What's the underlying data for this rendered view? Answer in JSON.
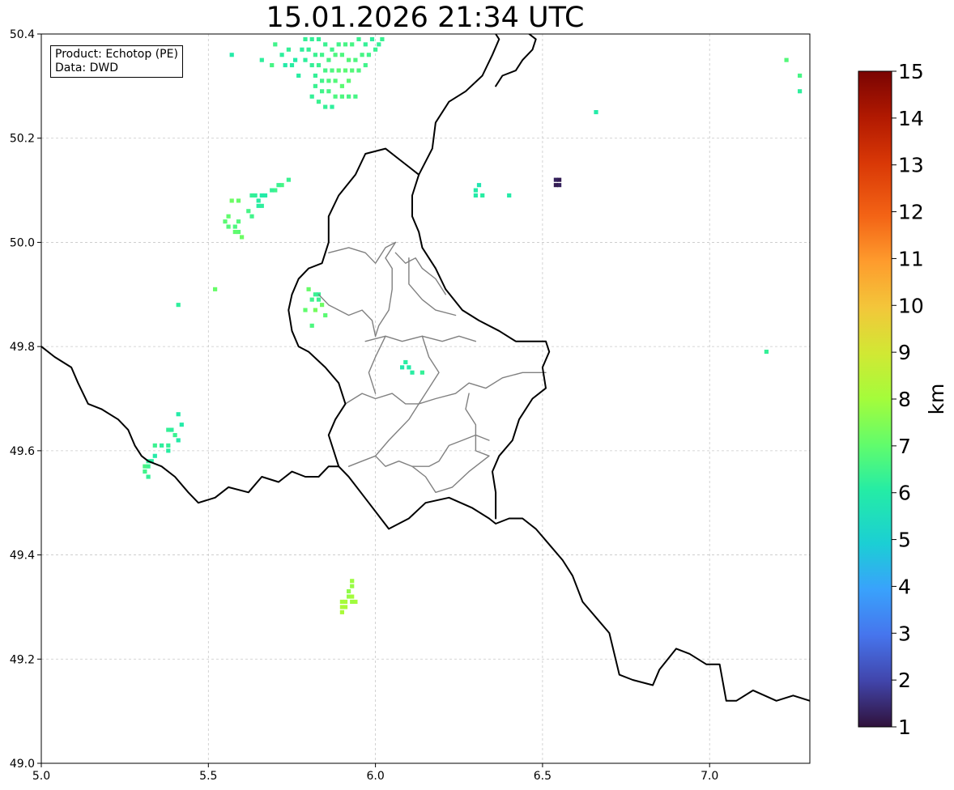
{
  "title": "15.01.2026 21:34 UTC",
  "info": {
    "product": "Product: Echotop (PE)",
    "source": "Data: DWD"
  },
  "map": {
    "lon_range": [
      5.0,
      7.3
    ],
    "lat_range": [
      49.0,
      50.4
    ],
    "lon_ticks": [
      "5.0",
      "5.5",
      "6.0",
      "6.5",
      "7.0"
    ],
    "lat_ticks": [
      "49.0",
      "49.2",
      "49.4",
      "49.6",
      "49.8",
      "50.0",
      "50.2",
      "50.4"
    ],
    "grid": true,
    "national_border_color": "#000000",
    "canton_border_color": "#808080",
    "national_borders": [
      [
        [
          5.0,
          49.8
        ],
        [
          5.04,
          49.78
        ],
        [
          5.09,
          49.76
        ],
        [
          5.11,
          49.73
        ],
        [
          5.14,
          49.69
        ],
        [
          5.18,
          49.68
        ],
        [
          5.23,
          49.66
        ],
        [
          5.26,
          49.64
        ],
        [
          5.28,
          49.61
        ],
        [
          5.3,
          49.59
        ],
        [
          5.32,
          49.58
        ],
        [
          5.36,
          49.57
        ],
        [
          5.4,
          49.55
        ],
        [
          5.44,
          49.52
        ],
        [
          5.47,
          49.5
        ],
        [
          5.52,
          49.51
        ],
        [
          5.56,
          49.53
        ],
        [
          5.62,
          49.52
        ],
        [
          5.66,
          49.55
        ],
        [
          5.71,
          49.54
        ],
        [
          5.75,
          49.56
        ],
        [
          5.79,
          49.55
        ],
        [
          5.83,
          49.55
        ],
        [
          5.86,
          49.57
        ],
        [
          5.89,
          49.57
        ]
      ],
      [
        [
          5.89,
          49.57
        ],
        [
          5.92,
          49.55
        ],
        [
          5.98,
          49.5
        ],
        [
          6.04,
          49.45
        ],
        [
          6.1,
          49.47
        ],
        [
          6.15,
          49.5
        ],
        [
          6.22,
          49.51
        ],
        [
          6.29,
          49.49
        ],
        [
          6.34,
          49.47
        ],
        [
          6.36,
          49.46
        ],
        [
          6.4,
          49.47
        ],
        [
          6.44,
          49.47
        ],
        [
          6.48,
          49.45
        ],
        [
          6.52,
          49.42
        ],
        [
          6.56,
          49.39
        ],
        [
          6.59,
          49.36
        ],
        [
          6.62,
          49.31
        ],
        [
          6.66,
          49.28
        ],
        [
          6.7,
          49.25
        ],
        [
          6.73,
          49.17
        ],
        [
          6.77,
          49.16
        ],
        [
          6.83,
          49.15
        ],
        [
          6.85,
          49.18
        ],
        [
          6.9,
          49.22
        ],
        [
          6.94,
          49.21
        ],
        [
          6.99,
          49.19
        ],
        [
          7.03,
          49.19
        ],
        [
          7.05,
          49.12
        ],
        [
          7.08,
          49.12
        ],
        [
          7.13,
          49.14
        ],
        [
          7.2,
          49.12
        ],
        [
          7.25,
          49.13
        ],
        [
          7.3,
          49.12
        ]
      ],
      [
        [
          5.89,
          49.57
        ],
        [
          5.86,
          49.63
        ],
        [
          5.88,
          49.66
        ],
        [
          5.91,
          49.69
        ],
        [
          5.89,
          49.73
        ],
        [
          5.85,
          49.76
        ],
        [
          5.8,
          49.79
        ],
        [
          5.77,
          49.8
        ],
        [
          5.75,
          49.83
        ],
        [
          5.74,
          49.87
        ],
        [
          5.75,
          49.9
        ],
        [
          5.77,
          49.93
        ],
        [
          5.8,
          49.95
        ],
        [
          5.84,
          49.96
        ],
        [
          5.86,
          50.0
        ],
        [
          5.86,
          50.05
        ],
        [
          5.89,
          50.09
        ],
        [
          5.94,
          50.13
        ],
        [
          5.97,
          50.17
        ],
        [
          6.03,
          50.18
        ],
        [
          6.07,
          50.16
        ],
        [
          6.13,
          50.13
        ],
        [
          6.11,
          50.09
        ],
        [
          6.11,
          50.05
        ],
        [
          6.13,
          50.02
        ],
        [
          6.14,
          49.99
        ],
        [
          6.18,
          49.95
        ],
        [
          6.21,
          49.91
        ],
        [
          6.26,
          49.87
        ],
        [
          6.31,
          49.85
        ],
        [
          6.37,
          49.83
        ],
        [
          6.42,
          49.81
        ],
        [
          6.48,
          49.81
        ],
        [
          6.51,
          49.81
        ],
        [
          6.52,
          49.79
        ],
        [
          6.5,
          49.76
        ],
        [
          6.51,
          49.72
        ],
        [
          6.47,
          49.7
        ],
        [
          6.43,
          49.66
        ],
        [
          6.41,
          49.62
        ],
        [
          6.37,
          49.59
        ],
        [
          6.35,
          49.56
        ],
        [
          6.36,
          49.52
        ],
        [
          6.36,
          49.47
        ]
      ],
      [
        [
          6.13,
          50.13
        ],
        [
          6.17,
          50.18
        ],
        [
          6.18,
          50.23
        ],
        [
          6.22,
          50.27
        ],
        [
          6.27,
          50.29
        ],
        [
          6.32,
          50.32
        ],
        [
          6.35,
          50.36
        ],
        [
          6.37,
          50.39
        ],
        [
          6.36,
          50.4
        ]
      ],
      [
        [
          6.46,
          50.4
        ],
        [
          6.48,
          50.39
        ],
        [
          6.47,
          50.37
        ],
        [
          6.44,
          50.35
        ],
        [
          6.42,
          50.33
        ],
        [
          6.38,
          50.32
        ],
        [
          6.36,
          50.3
        ]
      ]
    ],
    "canton_borders": [
      [
        [
          5.86,
          49.98
        ],
        [
          5.92,
          49.99
        ],
        [
          5.97,
          49.98
        ],
        [
          6.0,
          49.96
        ],
        [
          6.03,
          49.99
        ],
        [
          6.06,
          50.0
        ],
        [
          6.03,
          49.97
        ],
        [
          6.05,
          49.95
        ],
        [
          6.05,
          49.91
        ],
        [
          6.04,
          49.87
        ],
        [
          6.01,
          49.84
        ],
        [
          6.0,
          49.82
        ]
      ],
      [
        [
          6.06,
          49.98
        ],
        [
          6.09,
          49.96
        ],
        [
          6.12,
          49.97
        ],
        [
          6.14,
          49.95
        ],
        [
          6.18,
          49.93
        ],
        [
          6.21,
          49.9
        ]
      ],
      [
        [
          6.1,
          49.97
        ],
        [
          6.1,
          49.92
        ],
        [
          6.14,
          49.89
        ],
        [
          6.18,
          49.87
        ],
        [
          6.24,
          49.86
        ]
      ],
      [
        [
          5.83,
          49.9
        ],
        [
          5.86,
          49.88
        ],
        [
          5.89,
          49.87
        ],
        [
          5.92,
          49.86
        ],
        [
          5.96,
          49.87
        ],
        [
          5.99,
          49.85
        ],
        [
          6.0,
          49.82
        ]
      ],
      [
        [
          5.97,
          49.81
        ],
        [
          6.03,
          49.82
        ],
        [
          6.08,
          49.81
        ],
        [
          6.14,
          49.82
        ],
        [
          6.2,
          49.81
        ],
        [
          6.25,
          49.82
        ],
        [
          6.3,
          49.81
        ]
      ],
      [
        [
          6.03,
          49.82
        ],
        [
          6.0,
          49.78
        ],
        [
          5.98,
          49.75
        ],
        [
          6.0,
          49.71
        ]
      ],
      [
        [
          6.14,
          49.82
        ],
        [
          6.16,
          49.78
        ],
        [
          6.19,
          49.75
        ],
        [
          6.16,
          49.72
        ],
        [
          6.13,
          49.69
        ]
      ],
      [
        [
          5.91,
          49.69
        ],
        [
          5.96,
          49.71
        ],
        [
          6.0,
          49.7
        ],
        [
          6.05,
          49.71
        ],
        [
          6.09,
          49.69
        ],
        [
          6.13,
          49.69
        ],
        [
          6.18,
          49.7
        ],
        [
          6.24,
          49.71
        ],
        [
          6.28,
          49.73
        ],
        [
          6.33,
          49.72
        ],
        [
          6.38,
          49.74
        ],
        [
          6.44,
          49.75
        ],
        [
          6.51,
          49.75
        ]
      ],
      [
        [
          6.13,
          49.69
        ],
        [
          6.1,
          49.66
        ],
        [
          6.07,
          49.64
        ],
        [
          6.04,
          49.62
        ],
        [
          6.0,
          49.59
        ],
        [
          5.96,
          49.58
        ],
        [
          5.92,
          49.57
        ]
      ],
      [
        [
          6.0,
          49.59
        ],
        [
          6.03,
          49.57
        ],
        [
          6.07,
          49.58
        ],
        [
          6.11,
          49.57
        ],
        [
          6.16,
          49.57
        ],
        [
          6.19,
          49.58
        ],
        [
          6.22,
          49.61
        ],
        [
          6.26,
          49.62
        ],
        [
          6.3,
          49.63
        ],
        [
          6.34,
          49.62
        ]
      ],
      [
        [
          6.11,
          49.57
        ],
        [
          6.15,
          49.55
        ],
        [
          6.18,
          49.52
        ],
        [
          6.23,
          49.53
        ],
        [
          6.28,
          49.56
        ],
        [
          6.34,
          49.59
        ]
      ],
      [
        [
          6.28,
          49.71
        ],
        [
          6.27,
          49.68
        ],
        [
          6.3,
          49.65
        ],
        [
          6.3,
          49.6
        ],
        [
          6.34,
          49.59
        ]
      ]
    ]
  },
  "radar_cells": [
    [
      5.79,
      50.39,
      6.3
    ],
    [
      5.81,
      50.39,
      6.3
    ],
    [
      5.83,
      50.39,
      6.3
    ],
    [
      5.85,
      50.38,
      6.4
    ],
    [
      5.87,
      50.37,
      6.5
    ],
    [
      5.89,
      50.38,
      6.5
    ],
    [
      5.91,
      50.38,
      6.6
    ],
    [
      5.93,
      50.38,
      6.6
    ],
    [
      5.95,
      50.39,
      6.4
    ],
    [
      5.97,
      50.38,
      6.3
    ],
    [
      5.99,
      50.39,
      6.2
    ],
    [
      6.01,
      50.38,
      6.3
    ],
    [
      6.02,
      50.39,
      6.4
    ],
    [
      5.78,
      50.37,
      6.2
    ],
    [
      5.8,
      50.37,
      6.3
    ],
    [
      5.82,
      50.36,
      6.4
    ],
    [
      5.84,
      50.36,
      6.5
    ],
    [
      5.86,
      50.35,
      6.6
    ],
    [
      5.88,
      50.36,
      6.7
    ],
    [
      5.9,
      50.36,
      6.7
    ],
    [
      5.92,
      50.35,
      6.8
    ],
    [
      5.94,
      50.35,
      6.7
    ],
    [
      5.96,
      50.36,
      6.6
    ],
    [
      5.98,
      50.36,
      6.5
    ],
    [
      6.0,
      50.37,
      6.4
    ],
    [
      5.76,
      50.35,
      6.0
    ],
    [
      5.79,
      50.35,
      6.2
    ],
    [
      5.81,
      50.34,
      6.3
    ],
    [
      5.83,
      50.34,
      6.4
    ],
    [
      5.85,
      50.33,
      6.6
    ],
    [
      5.87,
      50.33,
      6.7
    ],
    [
      5.89,
      50.33,
      6.9
    ],
    [
      5.91,
      50.33,
      6.9
    ],
    [
      5.93,
      50.33,
      6.8
    ],
    [
      5.95,
      50.33,
      6.7
    ],
    [
      5.97,
      50.34,
      6.5
    ],
    [
      5.74,
      50.37,
      6.3
    ],
    [
      5.72,
      50.36,
      6.2
    ],
    [
      5.75,
      50.34,
      6.1
    ],
    [
      5.73,
      50.34,
      6.0
    ],
    [
      5.82,
      50.32,
      6.3
    ],
    [
      5.84,
      50.31,
      6.5
    ],
    [
      5.86,
      50.31,
      6.7
    ],
    [
      5.88,
      50.31,
      6.8
    ],
    [
      5.9,
      50.3,
      6.9
    ],
    [
      5.92,
      50.31,
      6.9
    ],
    [
      5.82,
      50.3,
      6.4
    ],
    [
      5.84,
      50.29,
      6.5
    ],
    [
      5.86,
      50.29,
      6.6
    ],
    [
      5.88,
      50.28,
      6.7
    ],
    [
      5.9,
      50.28,
      6.7
    ],
    [
      5.92,
      50.28,
      6.6
    ],
    [
      5.94,
      50.28,
      6.6
    ],
    [
      5.81,
      50.28,
      6.3
    ],
    [
      5.83,
      50.27,
      6.4
    ],
    [
      5.85,
      50.26,
      6.3
    ],
    [
      5.87,
      50.26,
      6.2
    ],
    [
      5.7,
      50.38,
      6.5
    ],
    [
      5.69,
      50.34,
      6.6
    ],
    [
      5.66,
      50.35,
      6.2
    ],
    [
      5.77,
      50.32,
      6.1
    ],
    [
      5.57,
      50.36,
      6.0
    ],
    [
      7.23,
      50.35,
      6.8
    ],
    [
      7.27,
      50.32,
      6.6
    ],
    [
      7.27,
      50.29,
      6.2
    ],
    [
      6.66,
      50.25,
      6.0
    ],
    [
      6.31,
      50.11,
      5.8
    ],
    [
      6.3,
      50.1,
      6.0
    ],
    [
      6.32,
      50.09,
      6.1
    ],
    [
      6.3,
      50.09,
      6.0
    ],
    [
      6.4,
      50.09,
      6.0
    ],
    [
      6.55,
      50.11,
      1.3
    ],
    [
      6.54,
      50.11,
      1.2
    ],
    [
      6.55,
      50.12,
      1.2
    ],
    [
      6.54,
      50.12,
      1.3
    ],
    [
      5.74,
      50.12,
      6.4
    ],
    [
      5.72,
      50.11,
      6.6
    ],
    [
      5.71,
      50.11,
      6.4
    ],
    [
      5.7,
      50.1,
      6.5
    ],
    [
      5.69,
      50.1,
      6.3
    ],
    [
      5.67,
      50.09,
      6.0
    ],
    [
      5.66,
      50.09,
      6.0
    ],
    [
      5.65,
      50.08,
      6.1
    ],
    [
      5.64,
      50.09,
      6.2
    ],
    [
      5.63,
      50.09,
      6.3
    ],
    [
      5.65,
      50.07,
      6.1
    ],
    [
      5.66,
      50.07,
      6.2
    ],
    [
      5.62,
      50.06,
      6.6
    ],
    [
      5.63,
      50.05,
      6.5
    ],
    [
      5.57,
      50.08,
      7.2
    ],
    [
      5.59,
      50.08,
      7.1
    ],
    [
      5.56,
      50.05,
      7.0
    ],
    [
      5.55,
      50.04,
      6.9
    ],
    [
      5.56,
      50.03,
      6.8
    ],
    [
      5.58,
      50.03,
      6.7
    ],
    [
      5.59,
      50.02,
      6.9
    ],
    [
      5.58,
      50.02,
      7.0
    ],
    [
      5.59,
      50.04,
      6.8
    ],
    [
      5.6,
      50.01,
      7.2
    ],
    [
      5.52,
      49.91,
      7.1
    ],
    [
      5.41,
      49.88,
      6.2
    ],
    [
      5.8,
      49.91,
      7.1
    ],
    [
      5.82,
      49.9,
      6.4
    ],
    [
      5.83,
      49.9,
      6.3
    ],
    [
      5.81,
      49.89,
      6.5
    ],
    [
      5.83,
      49.89,
      6.4
    ],
    [
      5.84,
      49.88,
      7.2
    ],
    [
      5.82,
      49.87,
      7.3
    ],
    [
      5.85,
      49.86,
      6.9
    ],
    [
      5.81,
      49.84,
      6.7
    ],
    [
      5.79,
      49.87,
      7.0
    ],
    [
      6.09,
      49.77,
      6.1
    ],
    [
      6.1,
      49.76,
      6.0
    ],
    [
      6.08,
      49.76,
      5.9
    ],
    [
      6.11,
      49.75,
      6.1
    ],
    [
      6.14,
      49.75,
      6.3
    ],
    [
      7.17,
      49.79,
      6.3
    ],
    [
      5.41,
      49.67,
      6.0
    ],
    [
      5.42,
      49.65,
      6.0
    ],
    [
      5.39,
      49.64,
      6.2
    ],
    [
      5.38,
      49.64,
      6.3
    ],
    [
      5.4,
      49.63,
      6.4
    ],
    [
      5.41,
      49.62,
      6.0
    ],
    [
      5.36,
      49.61,
      6.2
    ],
    [
      5.34,
      49.61,
      6.4
    ],
    [
      5.38,
      49.61,
      6.3
    ],
    [
      5.38,
      49.6,
      6.1
    ],
    [
      5.34,
      49.59,
      6.0
    ],
    [
      5.33,
      49.58,
      6.1
    ],
    [
      5.32,
      49.58,
      6.2
    ],
    [
      5.32,
      49.57,
      6.4
    ],
    [
      5.31,
      49.57,
      6.6
    ],
    [
      5.31,
      49.56,
      6.5
    ],
    [
      5.32,
      49.55,
      6.3
    ],
    [
      5.93,
      49.35,
      7.9
    ],
    [
      5.93,
      49.34,
      7.8
    ],
    [
      5.92,
      49.33,
      7.7
    ],
    [
      5.92,
      49.32,
      7.8
    ],
    [
      5.93,
      49.32,
      8.0
    ],
    [
      5.94,
      49.31,
      8.0
    ],
    [
      5.93,
      49.31,
      7.9
    ],
    [
      5.91,
      49.31,
      8.1
    ],
    [
      5.9,
      49.31,
      8.0
    ],
    [
      5.9,
      49.3,
      8.2
    ],
    [
      5.91,
      49.3,
      8.1
    ],
    [
      5.9,
      49.29,
      8.1
    ]
  ],
  "colorbar": {
    "min": 1,
    "max": 15,
    "ticks": [
      "1",
      "2",
      "3",
      "4",
      "5",
      "6",
      "7",
      "8",
      "9",
      "10",
      "11",
      "12",
      "13",
      "14",
      "15"
    ],
    "label": "km",
    "colormap": "turbo"
  }
}
